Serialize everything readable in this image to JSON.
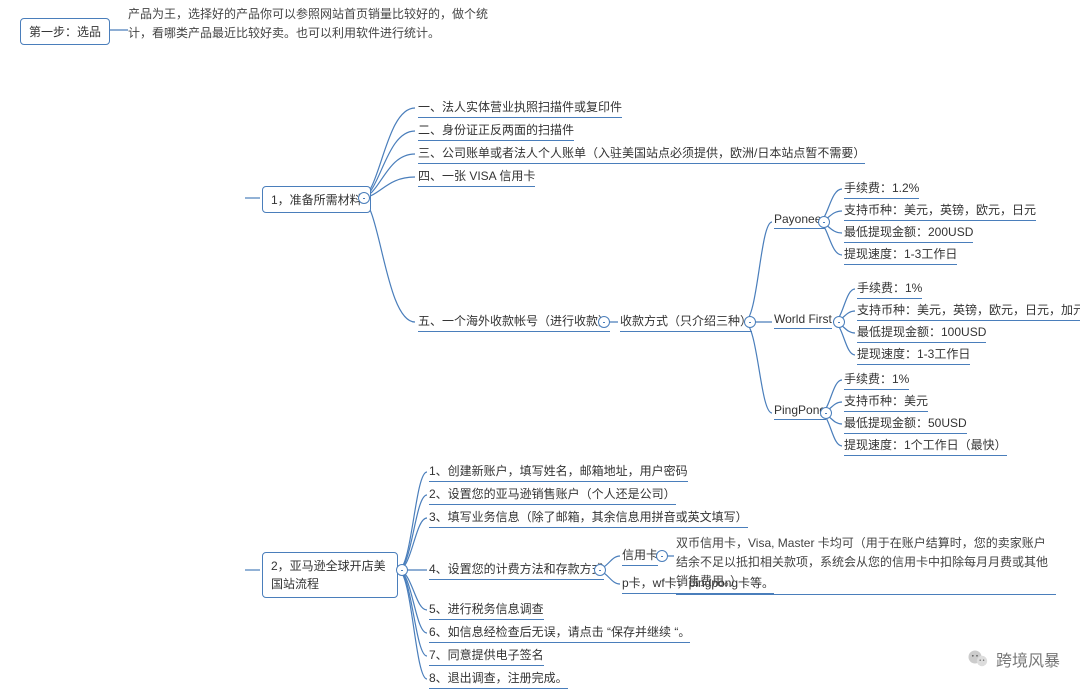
{
  "step1": {
    "label": "第一步：选品",
    "desc": "产品为王，选择好的产品你可以参照网站首页销量比较好的，做个统计，看哪类产品最近比较好卖。也可以利用软件进行统计。"
  },
  "materials": {
    "label": "1，准备所需材料",
    "items": {
      "i1": "一、法人实体营业执照扫描件或复印件",
      "i2": "二、身份证正反两面的扫描件",
      "i3": "三、公司账单或者法人个人账单（入驻美国站点必须提供，欧洲/日本站点暂不需要）",
      "i4": "四、一张 VISA 信用卡",
      "i5": "五、一个海外收款帐号（进行收款）"
    }
  },
  "payment_methods": {
    "label": "收款方式（只介绍三种）",
    "providers": {
      "payoneer": {
        "name": "Payoneer",
        "fee": "手续费：1.2%",
        "currencies": "支持币种：美元，英镑，欧元，日元",
        "min": "最低提现金额：200USD",
        "speed": "提现速度：1-3工作日"
      },
      "worldfirst": {
        "name": "World First",
        "fee": "手续费：1%",
        "currencies": "支持币种：美元，英镑，欧元，日元，加元(币种最多)",
        "min": "最低提现金额：100USD",
        "speed": "提现速度：1-3工作日"
      },
      "pingpong": {
        "name": "PingPong",
        "fee": "手续费：1%",
        "currencies": "支持币种：美元",
        "min": "最低提现金额：50USD",
        "speed": "提现速度：1个工作日（最快）"
      }
    }
  },
  "us_flow": {
    "label": "2，亚马逊全球开店美国站流程",
    "steps": {
      "s1": "1、创建新账户，填写姓名，邮箱地址，用户密码",
      "s2": "2、设置您的亚马逊销售账户（个人还是公司）",
      "s3": "3、填写业务信息（除了邮箱，其余信息用拼音或英文填写）",
      "s4": "4、设置您的计费方法和存款方式",
      "s5": "5、进行税务信息调查",
      "s6": "6、如信息经检查后无误，请点击 “保存并继续 “。",
      "s7": "7、同意提供电子签名",
      "s8": "8、退出调查，注册完成。"
    },
    "step4_split": {
      "cc_label": "信用卡",
      "cc_desc": "双币信用卡，Visa, Master 卡均可（用于在账户结算时，您的卖家账户结余不足以抵扣相关款项，系统会从您的信用卡中扣除每月月费或其他销售费用。）",
      "pcard": "p卡，wf卡，pingpong卡等。"
    }
  },
  "watermark": "跨境风暴"
}
